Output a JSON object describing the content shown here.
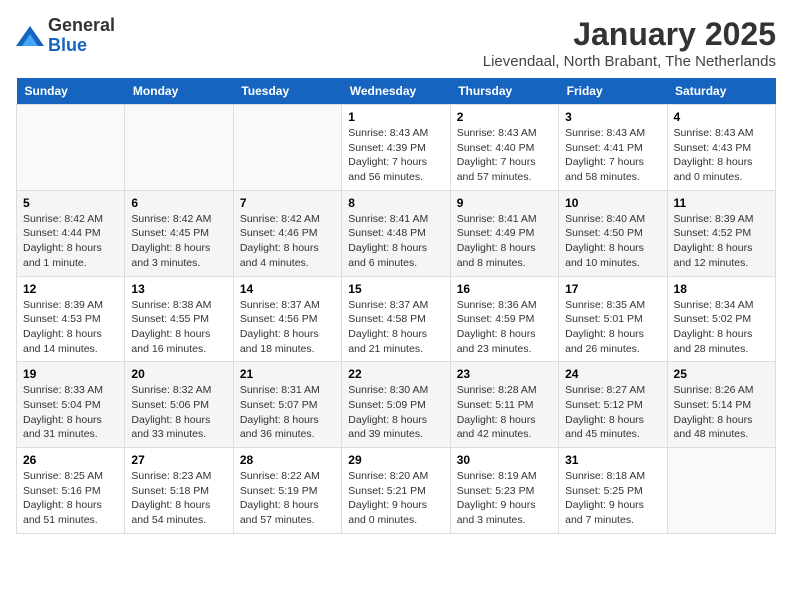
{
  "logo": {
    "general": "General",
    "blue": "Blue"
  },
  "title": "January 2025",
  "subtitle": "Lievendaal, North Brabant, The Netherlands",
  "weekdays": [
    "Sunday",
    "Monday",
    "Tuesday",
    "Wednesday",
    "Thursday",
    "Friday",
    "Saturday"
  ],
  "weeks": [
    [
      {
        "day": "",
        "info": ""
      },
      {
        "day": "",
        "info": ""
      },
      {
        "day": "",
        "info": ""
      },
      {
        "day": "1",
        "info": "Sunrise: 8:43 AM\nSunset: 4:39 PM\nDaylight: 7 hours and 56 minutes."
      },
      {
        "day": "2",
        "info": "Sunrise: 8:43 AM\nSunset: 4:40 PM\nDaylight: 7 hours and 57 minutes."
      },
      {
        "day": "3",
        "info": "Sunrise: 8:43 AM\nSunset: 4:41 PM\nDaylight: 7 hours and 58 minutes."
      },
      {
        "day": "4",
        "info": "Sunrise: 8:43 AM\nSunset: 4:43 PM\nDaylight: 8 hours and 0 minutes."
      }
    ],
    [
      {
        "day": "5",
        "info": "Sunrise: 8:42 AM\nSunset: 4:44 PM\nDaylight: 8 hours and 1 minute."
      },
      {
        "day": "6",
        "info": "Sunrise: 8:42 AM\nSunset: 4:45 PM\nDaylight: 8 hours and 3 minutes."
      },
      {
        "day": "7",
        "info": "Sunrise: 8:42 AM\nSunset: 4:46 PM\nDaylight: 8 hours and 4 minutes."
      },
      {
        "day": "8",
        "info": "Sunrise: 8:41 AM\nSunset: 4:48 PM\nDaylight: 8 hours and 6 minutes."
      },
      {
        "day": "9",
        "info": "Sunrise: 8:41 AM\nSunset: 4:49 PM\nDaylight: 8 hours and 8 minutes."
      },
      {
        "day": "10",
        "info": "Sunrise: 8:40 AM\nSunset: 4:50 PM\nDaylight: 8 hours and 10 minutes."
      },
      {
        "day": "11",
        "info": "Sunrise: 8:39 AM\nSunset: 4:52 PM\nDaylight: 8 hours and 12 minutes."
      }
    ],
    [
      {
        "day": "12",
        "info": "Sunrise: 8:39 AM\nSunset: 4:53 PM\nDaylight: 8 hours and 14 minutes."
      },
      {
        "day": "13",
        "info": "Sunrise: 8:38 AM\nSunset: 4:55 PM\nDaylight: 8 hours and 16 minutes."
      },
      {
        "day": "14",
        "info": "Sunrise: 8:37 AM\nSunset: 4:56 PM\nDaylight: 8 hours and 18 minutes."
      },
      {
        "day": "15",
        "info": "Sunrise: 8:37 AM\nSunset: 4:58 PM\nDaylight: 8 hours and 21 minutes."
      },
      {
        "day": "16",
        "info": "Sunrise: 8:36 AM\nSunset: 4:59 PM\nDaylight: 8 hours and 23 minutes."
      },
      {
        "day": "17",
        "info": "Sunrise: 8:35 AM\nSunset: 5:01 PM\nDaylight: 8 hours and 26 minutes."
      },
      {
        "day": "18",
        "info": "Sunrise: 8:34 AM\nSunset: 5:02 PM\nDaylight: 8 hours and 28 minutes."
      }
    ],
    [
      {
        "day": "19",
        "info": "Sunrise: 8:33 AM\nSunset: 5:04 PM\nDaylight: 8 hours and 31 minutes."
      },
      {
        "day": "20",
        "info": "Sunrise: 8:32 AM\nSunset: 5:06 PM\nDaylight: 8 hours and 33 minutes."
      },
      {
        "day": "21",
        "info": "Sunrise: 8:31 AM\nSunset: 5:07 PM\nDaylight: 8 hours and 36 minutes."
      },
      {
        "day": "22",
        "info": "Sunrise: 8:30 AM\nSunset: 5:09 PM\nDaylight: 8 hours and 39 minutes."
      },
      {
        "day": "23",
        "info": "Sunrise: 8:28 AM\nSunset: 5:11 PM\nDaylight: 8 hours and 42 minutes."
      },
      {
        "day": "24",
        "info": "Sunrise: 8:27 AM\nSunset: 5:12 PM\nDaylight: 8 hours and 45 minutes."
      },
      {
        "day": "25",
        "info": "Sunrise: 8:26 AM\nSunset: 5:14 PM\nDaylight: 8 hours and 48 minutes."
      }
    ],
    [
      {
        "day": "26",
        "info": "Sunrise: 8:25 AM\nSunset: 5:16 PM\nDaylight: 8 hours and 51 minutes."
      },
      {
        "day": "27",
        "info": "Sunrise: 8:23 AM\nSunset: 5:18 PM\nDaylight: 8 hours and 54 minutes."
      },
      {
        "day": "28",
        "info": "Sunrise: 8:22 AM\nSunset: 5:19 PM\nDaylight: 8 hours and 57 minutes."
      },
      {
        "day": "29",
        "info": "Sunrise: 8:20 AM\nSunset: 5:21 PM\nDaylight: 9 hours and 0 minutes."
      },
      {
        "day": "30",
        "info": "Sunrise: 8:19 AM\nSunset: 5:23 PM\nDaylight: 9 hours and 3 minutes."
      },
      {
        "day": "31",
        "info": "Sunrise: 8:18 AM\nSunset: 5:25 PM\nDaylight: 9 hours and 7 minutes."
      },
      {
        "day": "",
        "info": ""
      }
    ]
  ]
}
